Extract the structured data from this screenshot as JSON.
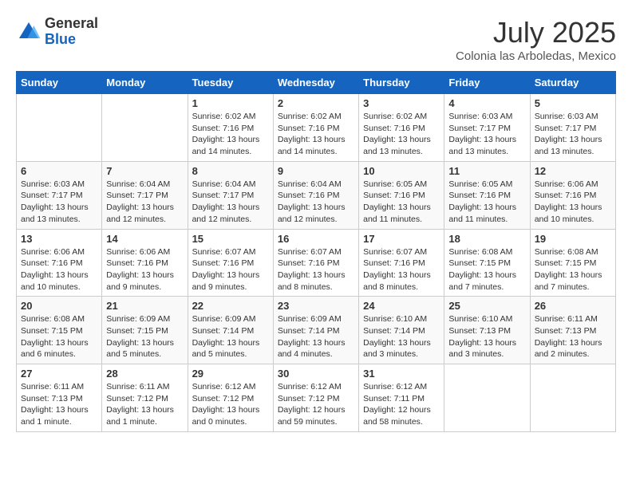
{
  "header": {
    "logo_general": "General",
    "logo_blue": "Blue",
    "month": "July 2025",
    "location": "Colonia las Arboledas, Mexico"
  },
  "days_of_week": [
    "Sunday",
    "Monday",
    "Tuesday",
    "Wednesday",
    "Thursday",
    "Friday",
    "Saturday"
  ],
  "weeks": [
    [
      {
        "day": "",
        "text": ""
      },
      {
        "day": "",
        "text": ""
      },
      {
        "day": "1",
        "text": "Sunrise: 6:02 AM\nSunset: 7:16 PM\nDaylight: 13 hours\nand 14 minutes."
      },
      {
        "day": "2",
        "text": "Sunrise: 6:02 AM\nSunset: 7:16 PM\nDaylight: 13 hours\nand 14 minutes."
      },
      {
        "day": "3",
        "text": "Sunrise: 6:02 AM\nSunset: 7:16 PM\nDaylight: 13 hours\nand 13 minutes."
      },
      {
        "day": "4",
        "text": "Sunrise: 6:03 AM\nSunset: 7:17 PM\nDaylight: 13 hours\nand 13 minutes."
      },
      {
        "day": "5",
        "text": "Sunrise: 6:03 AM\nSunset: 7:17 PM\nDaylight: 13 hours\nand 13 minutes."
      }
    ],
    [
      {
        "day": "6",
        "text": "Sunrise: 6:03 AM\nSunset: 7:17 PM\nDaylight: 13 hours\nand 13 minutes."
      },
      {
        "day": "7",
        "text": "Sunrise: 6:04 AM\nSunset: 7:17 PM\nDaylight: 13 hours\nand 12 minutes."
      },
      {
        "day": "8",
        "text": "Sunrise: 6:04 AM\nSunset: 7:17 PM\nDaylight: 13 hours\nand 12 minutes."
      },
      {
        "day": "9",
        "text": "Sunrise: 6:04 AM\nSunset: 7:16 PM\nDaylight: 13 hours\nand 12 minutes."
      },
      {
        "day": "10",
        "text": "Sunrise: 6:05 AM\nSunset: 7:16 PM\nDaylight: 13 hours\nand 11 minutes."
      },
      {
        "day": "11",
        "text": "Sunrise: 6:05 AM\nSunset: 7:16 PM\nDaylight: 13 hours\nand 11 minutes."
      },
      {
        "day": "12",
        "text": "Sunrise: 6:06 AM\nSunset: 7:16 PM\nDaylight: 13 hours\nand 10 minutes."
      }
    ],
    [
      {
        "day": "13",
        "text": "Sunrise: 6:06 AM\nSunset: 7:16 PM\nDaylight: 13 hours\nand 10 minutes."
      },
      {
        "day": "14",
        "text": "Sunrise: 6:06 AM\nSunset: 7:16 PM\nDaylight: 13 hours\nand 9 minutes."
      },
      {
        "day": "15",
        "text": "Sunrise: 6:07 AM\nSunset: 7:16 PM\nDaylight: 13 hours\nand 9 minutes."
      },
      {
        "day": "16",
        "text": "Sunrise: 6:07 AM\nSunset: 7:16 PM\nDaylight: 13 hours\nand 8 minutes."
      },
      {
        "day": "17",
        "text": "Sunrise: 6:07 AM\nSunset: 7:16 PM\nDaylight: 13 hours\nand 8 minutes."
      },
      {
        "day": "18",
        "text": "Sunrise: 6:08 AM\nSunset: 7:15 PM\nDaylight: 13 hours\nand 7 minutes."
      },
      {
        "day": "19",
        "text": "Sunrise: 6:08 AM\nSunset: 7:15 PM\nDaylight: 13 hours\nand 7 minutes."
      }
    ],
    [
      {
        "day": "20",
        "text": "Sunrise: 6:08 AM\nSunset: 7:15 PM\nDaylight: 13 hours\nand 6 minutes."
      },
      {
        "day": "21",
        "text": "Sunrise: 6:09 AM\nSunset: 7:15 PM\nDaylight: 13 hours\nand 5 minutes."
      },
      {
        "day": "22",
        "text": "Sunrise: 6:09 AM\nSunset: 7:14 PM\nDaylight: 13 hours\nand 5 minutes."
      },
      {
        "day": "23",
        "text": "Sunrise: 6:09 AM\nSunset: 7:14 PM\nDaylight: 13 hours\nand 4 minutes."
      },
      {
        "day": "24",
        "text": "Sunrise: 6:10 AM\nSunset: 7:14 PM\nDaylight: 13 hours\nand 3 minutes."
      },
      {
        "day": "25",
        "text": "Sunrise: 6:10 AM\nSunset: 7:13 PM\nDaylight: 13 hours\nand 3 minutes."
      },
      {
        "day": "26",
        "text": "Sunrise: 6:11 AM\nSunset: 7:13 PM\nDaylight: 13 hours\nand 2 minutes."
      }
    ],
    [
      {
        "day": "27",
        "text": "Sunrise: 6:11 AM\nSunset: 7:13 PM\nDaylight: 13 hours\nand 1 minute."
      },
      {
        "day": "28",
        "text": "Sunrise: 6:11 AM\nSunset: 7:12 PM\nDaylight: 13 hours\nand 1 minute."
      },
      {
        "day": "29",
        "text": "Sunrise: 6:12 AM\nSunset: 7:12 PM\nDaylight: 13 hours\nand 0 minutes."
      },
      {
        "day": "30",
        "text": "Sunrise: 6:12 AM\nSunset: 7:12 PM\nDaylight: 12 hours\nand 59 minutes."
      },
      {
        "day": "31",
        "text": "Sunrise: 6:12 AM\nSunset: 7:11 PM\nDaylight: 12 hours\nand 58 minutes."
      },
      {
        "day": "",
        "text": ""
      },
      {
        "day": "",
        "text": ""
      }
    ]
  ]
}
